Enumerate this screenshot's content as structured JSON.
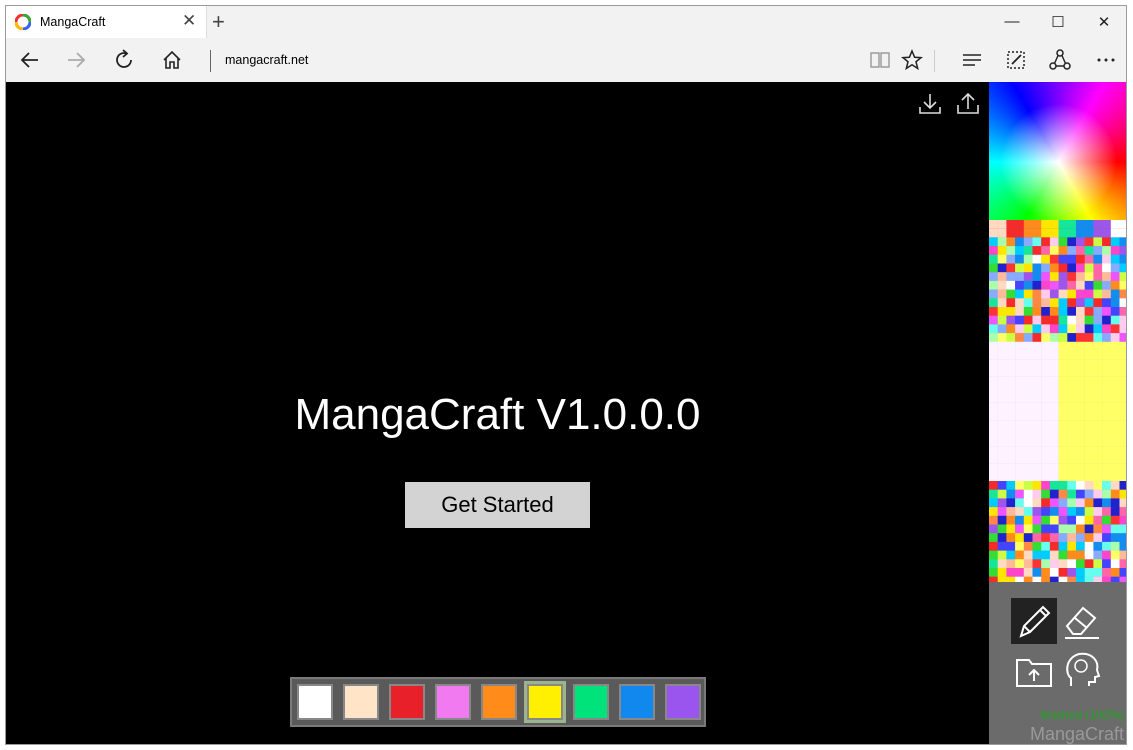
{
  "browser": {
    "tab_title": "MangaCraft",
    "address": "mangacraft.net"
  },
  "page": {
    "headline": "MangaCraft V1.0.0.0",
    "cta_label": "Get Started"
  },
  "palette": {
    "colors": [
      "#ffffff",
      "#ffe4c8",
      "#e8202a",
      "#f27af0",
      "#ff8c1a",
      "#ffef00",
      "#00e27a",
      "#1188ee",
      "#9955ee"
    ],
    "selected_index": 5
  },
  "sidebar": {
    "status_text": "finished (100%)",
    "brand_text": "MangaCraft"
  },
  "icons": {
    "back": "back-arrow-icon",
    "forward": "forward-arrow-icon",
    "refresh": "refresh-icon",
    "home": "home-icon",
    "reading": "reading-view-icon",
    "favorite": "star-icon",
    "hub": "hub-icon",
    "notes": "web-note-icon",
    "share": "share-icon",
    "more": "more-icon",
    "download": "download-icon",
    "upload": "upload-icon",
    "pencil": "pencil-icon",
    "eraser": "eraser-icon",
    "open_folder": "folder-upload-icon",
    "brain": "brain-icon"
  }
}
